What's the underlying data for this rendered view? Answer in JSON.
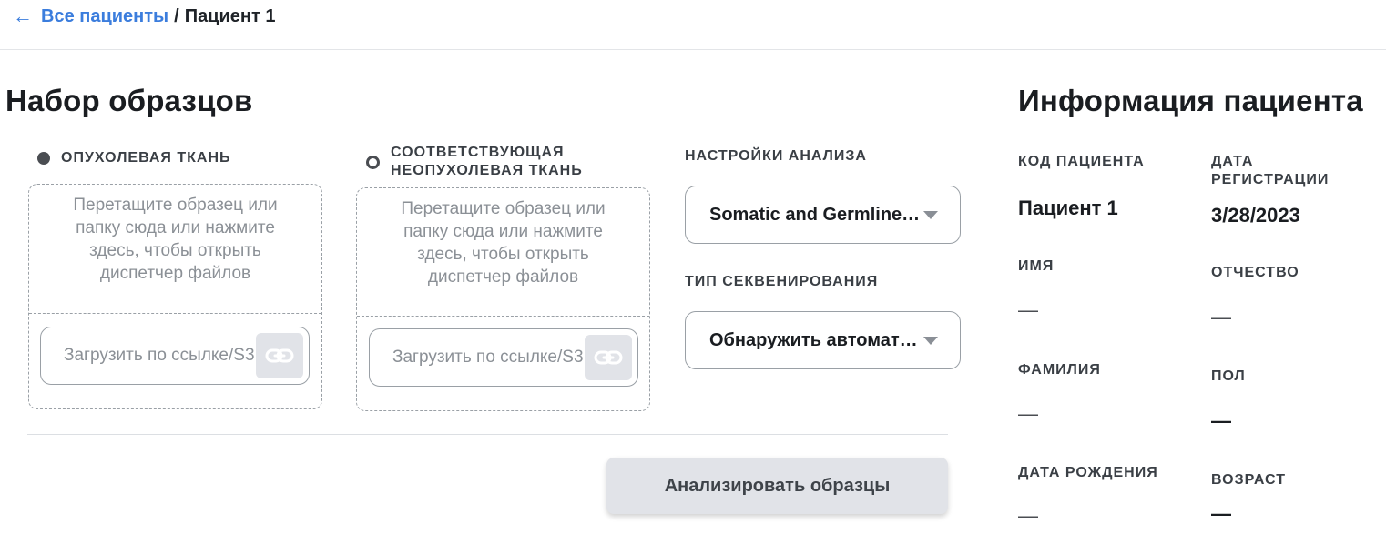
{
  "breadcrumb": {
    "back_arrow": "←",
    "parent": "Все пациенты",
    "separator": "/",
    "current": "Пациент 1"
  },
  "samples": {
    "title": "Набор образцов",
    "tumor": {
      "label": "ОПУХОЛЕВАЯ ТКАНЬ",
      "drop_text": "Перетащите образец или папку сюда или нажмите здесь, чтобы открыть диспетчер файлов",
      "url_placeholder": "Загрузить по ссылке/S3"
    },
    "normal": {
      "label_line1": "СООТВЕТСТВУЮЩАЯ",
      "label_line2": "НЕОПУХОЛЕВАЯ ТКАНЬ",
      "drop_text": "Перетащите образец или папку сюда или нажмите здесь, чтобы открыть диспетчер файлов",
      "url_placeholder": "Загрузить по ссылке/S3"
    },
    "analysis_settings": {
      "label": "НАСТРОЙКИ АНАЛИЗА",
      "value": "Somatic and Germline analysis"
    },
    "sequencing_type": {
      "label": "ТИП СЕКВЕНИРОВАНИЯ",
      "value": "Обнаружить автоматически"
    },
    "analyze_button": "Анализировать образцы"
  },
  "patient_info": {
    "title": "Информация пациента",
    "code": {
      "label": "КОД ПАЦИЕНТА",
      "value": "Пациент 1"
    },
    "reg_date": {
      "label_line1": "ДАТА",
      "label_line2": "РЕГИСТРАЦИИ",
      "value": "3/28/2023"
    },
    "first_name": {
      "label": "ИМЯ",
      "value": "—"
    },
    "patronymic": {
      "label": "ОТЧЕСТВО",
      "value": "—"
    },
    "last_name": {
      "label": "ФАМИЛИЯ",
      "value": "—"
    },
    "sex": {
      "label": "ПОЛ",
      "value": "—"
    },
    "birth_date": {
      "label": "ДАТА РОЖДЕНИЯ",
      "value": "—"
    },
    "age": {
      "label": "ВОЗРАСТ",
      "value": "—"
    }
  },
  "colors": {
    "link": "#3b7ddd",
    "button_bg": "#e1e3e8",
    "border": "#9aa0a6"
  },
  "icons": {
    "back": "arrow-left-icon",
    "link": "link-icon",
    "dropdown": "caret-down-icon",
    "tumor_radio": "radio-filled-icon",
    "normal_radio": "radio-empty-icon"
  }
}
